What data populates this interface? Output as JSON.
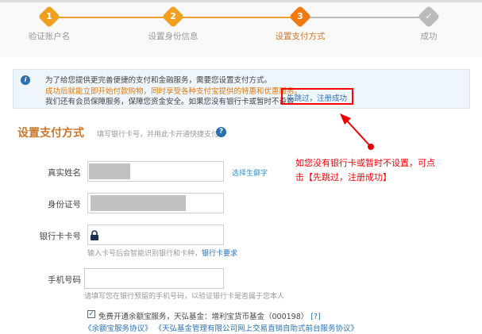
{
  "steps": [
    {
      "num": "1",
      "label": "验证账户名",
      "state": "done"
    },
    {
      "num": "2",
      "label": "设置身份信息",
      "state": "done"
    },
    {
      "num": "3",
      "label": "设置支付方式",
      "state": "current"
    },
    {
      "num": "",
      "label": "成功",
      "state": "todo"
    }
  ],
  "info": {
    "line1": "为了给您提供更完善便捷的支付和金融服务，需要您设置支付方式。",
    "line2": "成功后就能立即开始付款购物，同时享受各种支付宝提供的特惠和优惠服务。",
    "line3": "我们还有会员保障服务，保障您资金安全。如果您没有银行卡或暂时不设置",
    "skip_link": "先跳过，注册成功"
  },
  "section": {
    "title": "设置支付方式",
    "subtitle": "填写银行卡号，并用此卡开通快捷支付",
    "help": "?"
  },
  "form": {
    "name_label": "真实姓名",
    "name_link": "选择生僻字",
    "id_label": "身份证号",
    "card_label": "银行卡卡号",
    "card_hint": "输入卡号后会智能识别银行和卡种，",
    "card_hint_link": "银行卡要求",
    "phone_label": "手机号码",
    "phone_hint": "请填写您在银行预留的手机号码，以验证银行卡是否属于您本人",
    "agree_text": "免费开通余额宝服务，天弘基金：增利宝货币基金（000198）",
    "agree_help": "[?]",
    "agreement1": "《余额宝服务协议》",
    "agreement2": "《天弘基金管理有限公司网上交易直销自助式前台服务协议》"
  },
  "annotation": {
    "line1": "如您没有银行卡或暂时不设置，可点",
    "line2": "击【先跳过，注册成功】"
  },
  "colors": {
    "orange": "#f0a020",
    "current": "#f07a10",
    "gray": "#bbbbbb",
    "red": "#ff0000",
    "link": "#2a72b5"
  }
}
